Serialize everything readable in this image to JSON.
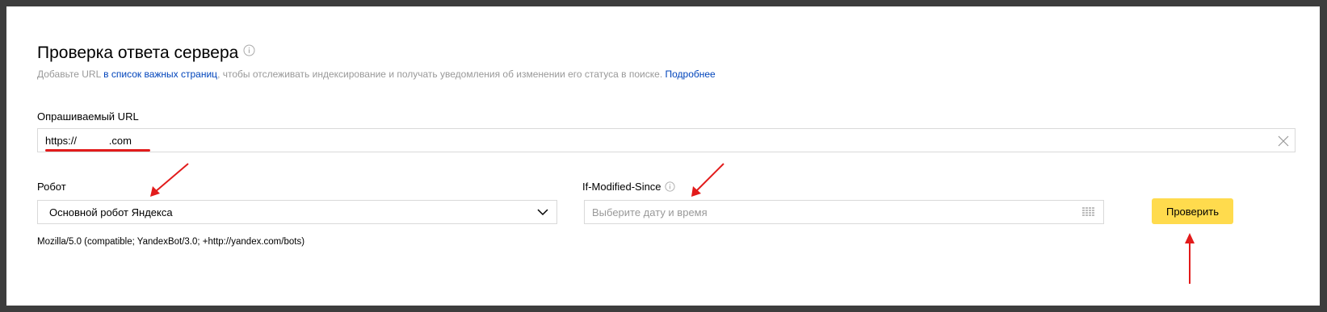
{
  "header": {
    "title": "Проверка ответа сервера",
    "subtitle_before": "Добавьте URL ",
    "subtitle_link": "в список важных страниц",
    "subtitle_middle": ", чтобы отслеживать индексирование и получать уведомления об изменении его статуса в поиске. ",
    "more_link": "Подробнее"
  },
  "url_field": {
    "label": "Опрашиваемый URL",
    "value": "https://           .com"
  },
  "robot": {
    "label": "Робот",
    "selected": "Основной робот Яндекса",
    "user_agent": "Mozilla/5.0 (compatible; YandexBot/3.0; +http://yandex.com/bots)"
  },
  "if_modified_since": {
    "label": "If-Modified-Since",
    "placeholder": "Выберите дату и время"
  },
  "check_button": {
    "label": "Проверить"
  },
  "colors": {
    "accent": "#ffdb4d",
    "link": "#0044bb",
    "annotation": "#e21b1b"
  }
}
